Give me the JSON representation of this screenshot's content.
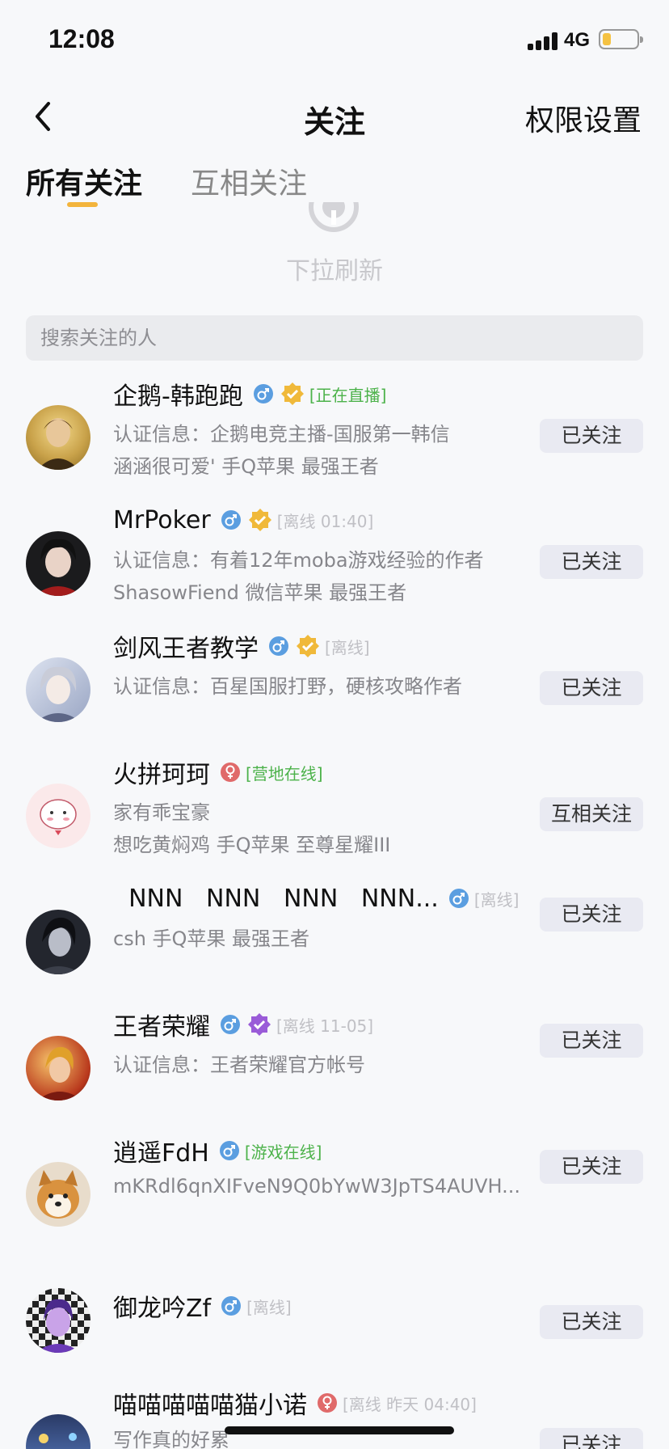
{
  "status_bar": {
    "time": "12:08",
    "network": "4G"
  },
  "nav": {
    "title": "关注",
    "right_action": "权限设置"
  },
  "tabs": [
    {
      "label": "所有关注",
      "active": true
    },
    {
      "label": "互相关注",
      "active": false
    }
  ],
  "refresh": {
    "text": "下拉刷新"
  },
  "search": {
    "placeholder": "搜索关注的人"
  },
  "colors": {
    "accent": "#f3b43c",
    "online": "#4cb24a",
    "offline": "#c0c0c5",
    "male": "#5b9ee0",
    "female": "#e06a6a",
    "verified_gold": "#f0b93a",
    "verified_purple": "#9a5bd8"
  },
  "users": [
    {
      "name": "企鹅-韩跑跑",
      "gender": "male",
      "badge": "gold-verified-icon",
      "status": "[正在直播]",
      "online": true,
      "lines": [
        "认证信息：企鹅电竞主播-国服第一韩信",
        "涵涵很可爱' 手Q苹果 最强王者"
      ],
      "button": "已关注"
    },
    {
      "name": "MrPoker",
      "gender": "male",
      "badge": "gold-verified-icon",
      "status": "[离线 01:40]",
      "online": false,
      "lines": [
        "认证信息：有着12年moba游戏经验的作者",
        "ShasowFiend 微信苹果 最强王者"
      ],
      "button": "已关注"
    },
    {
      "name": "剑风王者教学",
      "gender": "male",
      "badge": "gold-verified-icon",
      "status": "[离线]",
      "online": false,
      "lines": [
        "认证信息：百星国服打野，硬核攻略作者"
      ],
      "button": "已关注"
    },
    {
      "name": "火拼珂珂",
      "gender": "female",
      "badge": "",
      "status": "[营地在线]",
      "online": true,
      "lines": [
        "家有乖宝豪",
        "想吃黄焖鸡    手Q苹果 至尊星耀III"
      ],
      "button": "互相关注"
    },
    {
      "name": "  NNN   NNN   NNN   NNN...",
      "gender": "male",
      "badge": "",
      "status": "[离线]",
      "online": false,
      "lines": [
        "csh 手Q苹果 最强王者"
      ],
      "button": "已关注"
    },
    {
      "name": "王者荣耀",
      "gender": "male",
      "badge": "purple-verified-icon",
      "status": "[离线 11-05]",
      "online": false,
      "lines": [
        "认证信息：王者荣耀官方帐号"
      ],
      "button": "已关注"
    },
    {
      "name": "逍遥FdH",
      "gender": "male",
      "badge": "",
      "status": "[游戏在线]",
      "online": true,
      "lines": [
        "mKRdl6qnXIFveN9Q0bYwW3JpTS4AUVH..."
      ],
      "button": "已关注"
    },
    {
      "name": "御龙吟Zf",
      "gender": "male",
      "badge": "",
      "status": "[离线]",
      "online": false,
      "lines": [],
      "button": "已关注"
    },
    {
      "name": "喵喵喵喵喵猫小诺",
      "gender": "female",
      "badge": "",
      "status": "[离线 昨天 04:40]",
      "online": false,
      "lines": [
        "写作真的好累"
      ],
      "button": "已关注"
    }
  ]
}
